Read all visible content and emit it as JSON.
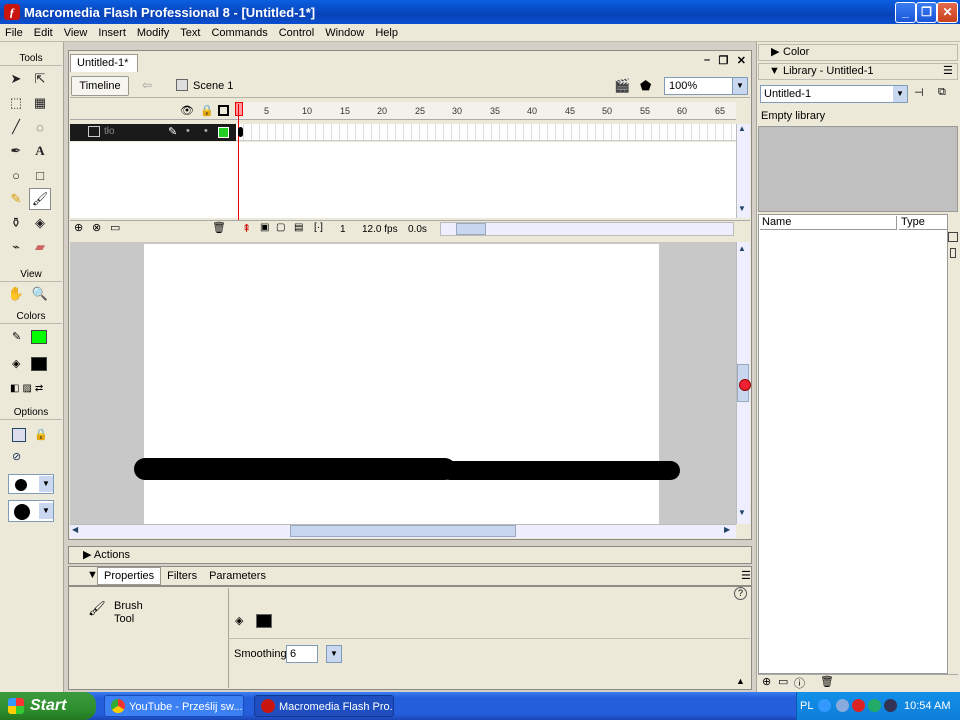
{
  "window": {
    "title": "Macromedia Flash Professional 8 - [Untitled-1*]",
    "min": "_",
    "max": "❐",
    "close": "✕"
  },
  "menu": [
    "File",
    "Edit",
    "View",
    "Insert",
    "Modify",
    "Text",
    "Commands",
    "Control",
    "Window",
    "Help"
  ],
  "tools": {
    "title": "Tools",
    "view_label": "View",
    "colors_label": "Colors",
    "options_label": "Options"
  },
  "colors": {
    "stroke": "#00ff00",
    "fill": "#000000",
    "accent": "#245edb"
  },
  "document": {
    "tab": "Untitled-1*",
    "timeline_button": "Timeline",
    "scene": "Scene 1",
    "zoom": "100%"
  },
  "timeline": {
    "ticks": [
      "1",
      "5",
      "10",
      "15",
      "20",
      "25",
      "30",
      "35",
      "40",
      "45",
      "50",
      "55",
      "60",
      "65"
    ],
    "layer_name": "tło",
    "frame": "1",
    "fps": "12.0 fps",
    "time": "0.0s"
  },
  "panels": {
    "actions": "Actions",
    "properties_tabs": [
      "Properties",
      "Filters",
      "Parameters"
    ],
    "tool_name_line1": "Brush",
    "tool_name_line2": "Tool",
    "smoothing_label": "Smoothing",
    "smoothing_value": "6"
  },
  "right": {
    "color": "Color",
    "library": "Library - Untitled-1",
    "library_select": "Untitled-1",
    "empty": "Empty library",
    "col_name": "Name",
    "col_type": "Type"
  },
  "taskbar": {
    "start": "Start",
    "task1": "YouTube - Prześlij sw...",
    "task2": "Macromedia Flash Pro...",
    "lang": "PL",
    "clock": "10:54 AM"
  }
}
